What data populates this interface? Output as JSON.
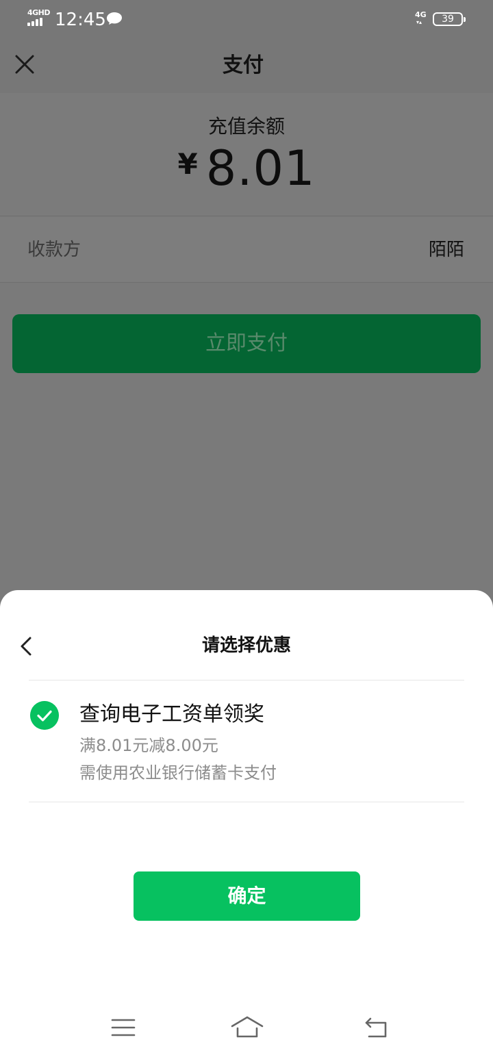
{
  "status_bar": {
    "network": "4GHD",
    "time": "12:45",
    "mobile_data": "4G",
    "battery": "39"
  },
  "header": {
    "title": "支付"
  },
  "payment": {
    "amount_label": "充值余额",
    "currency_symbol": "¥",
    "amount": "8.01",
    "payee_label": "收款方",
    "payee_value": "陌陌",
    "pay_button": "立即支付"
  },
  "sheet": {
    "title": "请选择优惠",
    "option": {
      "selected": true,
      "title": "查询电子工资单领奖",
      "line1": "满8.01元减8.00元",
      "line2": "需使用农业银行储蓄卡支付"
    },
    "confirm_button": "确定"
  },
  "colors": {
    "brand_green": "#07c160",
    "overlay_pay_button": "#046533"
  }
}
